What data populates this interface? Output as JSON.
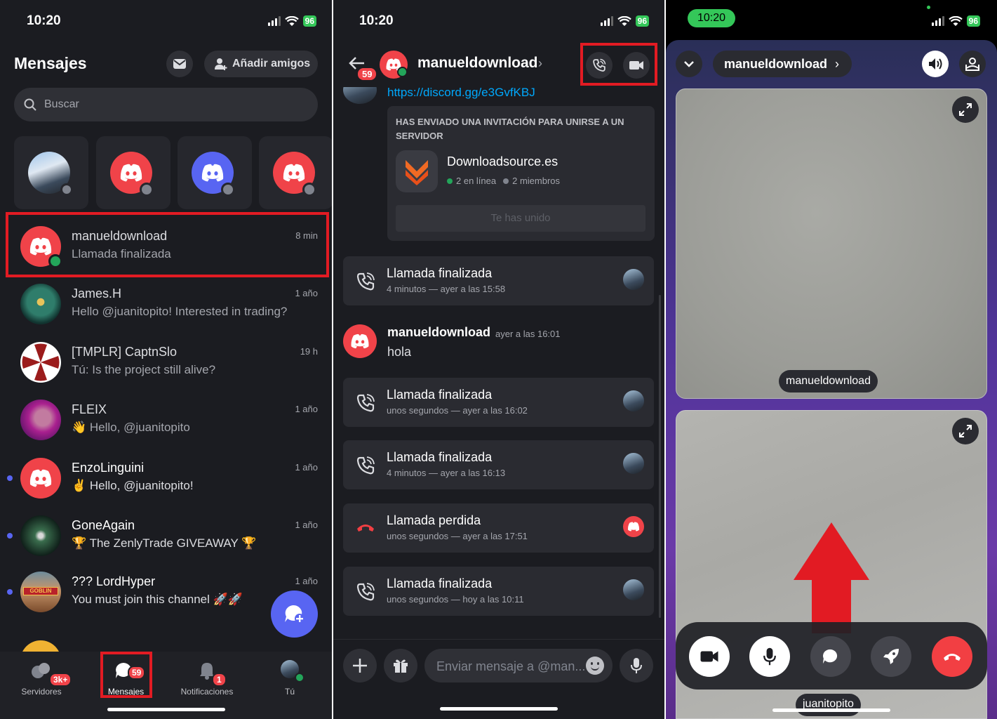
{
  "status": {
    "time": "10:20",
    "battery": "96"
  },
  "p1": {
    "title": "Mensajes",
    "add_friends": "Añadir amigos",
    "search_placeholder": "Buscar",
    "conversations": [
      {
        "name": "manueldownload",
        "subtitle": "Llamada finalizada",
        "time": "8 min"
      },
      {
        "name": "James.H",
        "subtitle": "Hello @juanitopito! Interested in trading?",
        "time": "1 año"
      },
      {
        "name": "[TMPLR] CaptnSlo",
        "subtitle": "Tú: Is the project still alive?",
        "time": "19 h"
      },
      {
        "name": "FLEIX",
        "subtitle": "👋 Hello, @juanitopito",
        "time": "1 año"
      },
      {
        "name": "EnzoLinguini",
        "subtitle": "✌️ Hello, @juanitopito!",
        "time": "1 año"
      },
      {
        "name": "GoneAgain",
        "subtitle": "🏆 The ZenlyTrade GIVEAWAY 🏆",
        "time": "1 año"
      },
      {
        "name": "??? LordHyper",
        "subtitle": "You must join this channel 🚀🚀",
        "time": "1 año"
      }
    ],
    "goblin_label": "GOBLIN",
    "nav": [
      {
        "label": "Servidores",
        "badge": "3k+"
      },
      {
        "label": "Mensajes",
        "badge": "59"
      },
      {
        "label": "Notificaciones",
        "badge": "1"
      },
      {
        "label": "Tú",
        "badge": ""
      }
    ]
  },
  "p2": {
    "back_badge": "59",
    "username": "manueldownload",
    "link": "https://discord.gg/e3GvfKBJ",
    "invite": {
      "heading": "HAS ENVIADO UNA INVITACIÓN PARA UNIRSE A UN SERVIDOR",
      "server": "Downloadsource.es",
      "online": "2 en línea",
      "members": "2 miembros",
      "button": "Te has unido"
    },
    "calls": [
      {
        "title": "Llamada finalizada",
        "sub": "4 minutos — ayer a las 15:58"
      },
      {
        "title": "Llamada finalizada",
        "sub": "unos segundos — ayer a las 16:02"
      },
      {
        "title": "Llamada finalizada",
        "sub": "4 minutos — ayer a las 16:13"
      },
      {
        "title": "Llamada perdida",
        "sub": "unos segundos — ayer a las 17:51"
      },
      {
        "title": "Llamada finalizada",
        "sub": "unos segundos — hoy a las 10:11"
      }
    ],
    "message": {
      "author": "manueldownload",
      "time": "ayer a las 16:01",
      "text": "hola"
    },
    "composer_placeholder": "Enviar mensaje a @man..."
  },
  "p3": {
    "username": "manueldownload",
    "tile1_label": "manueldownload",
    "tile2_label": "juanitopito"
  },
  "colors": {
    "highlight": "#e21b23",
    "discord_red": "#f04349",
    "blurple": "#5865f2",
    "online": "#23a55a"
  }
}
